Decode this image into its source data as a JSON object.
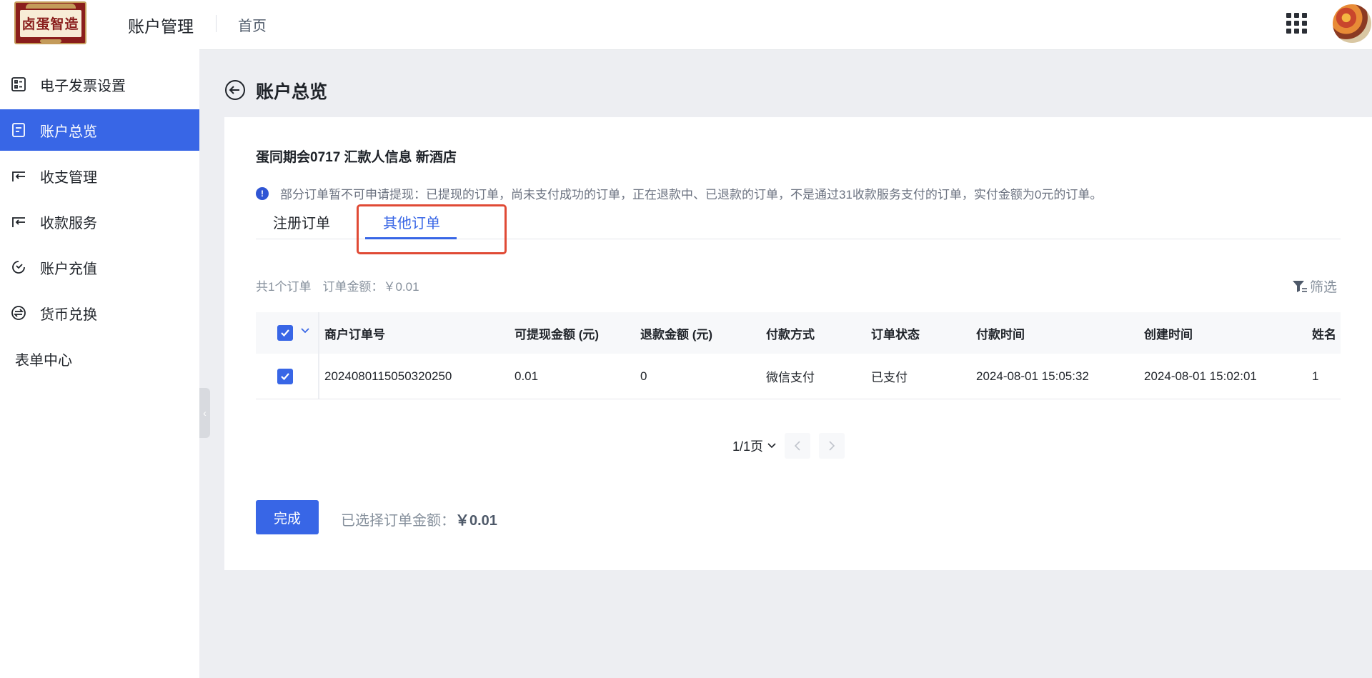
{
  "header": {
    "logo_text": "卤蛋智造",
    "app_title": "账户管理",
    "home_link": "首页"
  },
  "sidebar": {
    "items": [
      {
        "label": "电子发票设置",
        "icon": "invoice-settings-icon"
      },
      {
        "label": "账户总览",
        "icon": "document-icon",
        "active": true
      },
      {
        "label": "收支管理",
        "icon": "exchange-icon"
      },
      {
        "label": "收款服务",
        "icon": "exchange-icon"
      },
      {
        "label": "账户充值",
        "icon": "recharge-icon"
      },
      {
        "label": "货币兑换",
        "icon": "currency-icon"
      },
      {
        "label": "表单中心"
      }
    ]
  },
  "page": {
    "title": "账户总览"
  },
  "card": {
    "store_title": "蛋同期会0717 汇款人信息 新酒店",
    "notice": "部分订单暂不可申请提现：已提现的订单，尚未支付成功的订单，正在退款中、已退款的订单，不是通过31收款服务支付的订单，实付金额为0元的订单。",
    "tabs": [
      {
        "label": "注册订单",
        "active": false
      },
      {
        "label": "其他订单",
        "active": true
      }
    ],
    "summary": {
      "count": "共1个订单",
      "amount": "订单金额：￥0.01"
    },
    "filter_label": "筛选"
  },
  "table": {
    "columns": [
      "商户订单号",
      "可提现金额 (元)",
      "退款金额 (元)",
      "付款方式",
      "订单状态",
      "付款时间",
      "创建时间",
      "姓名"
    ],
    "rows": [
      {
        "order_no": "2024080115050320250",
        "withdrawable": "0.01",
        "refund": "0",
        "pay_method": "微信支付",
        "status": "已支付",
        "pay_time": "2024-08-01 15:05:32",
        "create_time": "2024-08-01 15:02:01",
        "name": "1",
        "checked": true
      }
    ]
  },
  "pager": {
    "text": "1/1页"
  },
  "footer": {
    "done_label": "完成",
    "selected_label": "已选择订单金额：",
    "selected_value": "￥0.01"
  },
  "colors": {
    "primary": "#3866e6",
    "highlight": "#e04a35"
  }
}
